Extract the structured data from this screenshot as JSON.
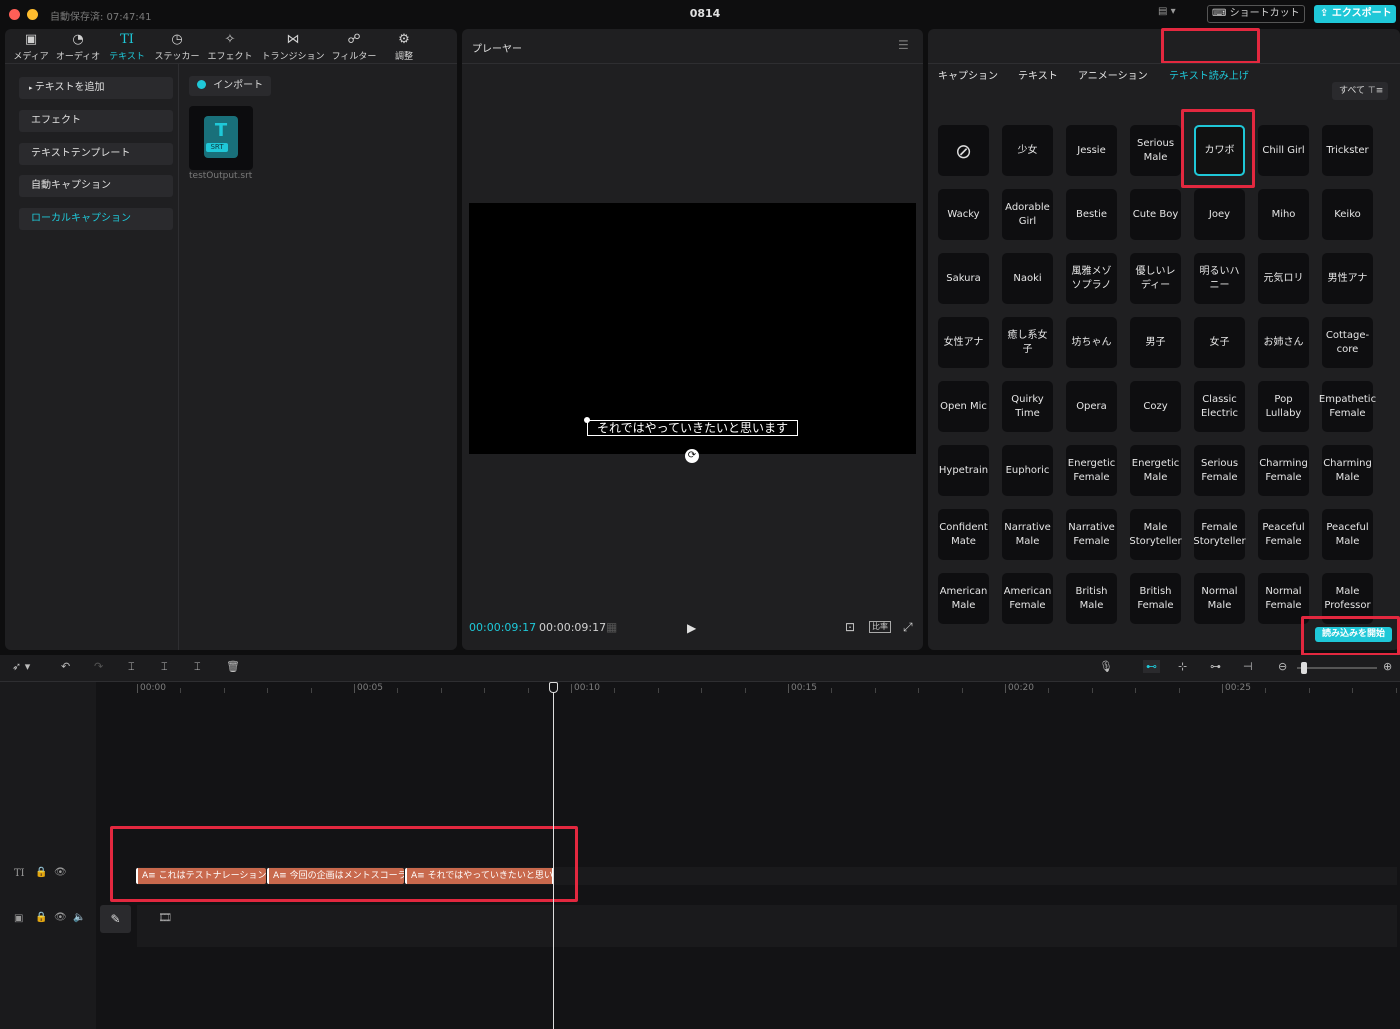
{
  "window": {
    "autosave": "自動保存済: 07:47:41",
    "title": "0814",
    "shortcut_label": "ショートカット",
    "export_label": "エクスポート"
  },
  "toolbar": {
    "tools": [
      {
        "label": "メディア",
        "icon": "media-icon"
      },
      {
        "label": "オーディオ",
        "icon": "audio-icon"
      },
      {
        "label": "テキスト",
        "icon": "text-icon"
      },
      {
        "label": "ステッカー",
        "icon": "sticker-icon"
      },
      {
        "label": "エフェクト",
        "icon": "effect-icon"
      },
      {
        "label": "トランジション",
        "icon": "transition-icon"
      },
      {
        "label": "フィルター",
        "icon": "filter-icon"
      },
      {
        "label": "調整",
        "icon": "adjust-icon"
      }
    ]
  },
  "sidebar": {
    "items": [
      "テキストを追加",
      "エフェクト",
      "テキストテンプレート",
      "自動キャプション",
      "ローカルキャプション"
    ]
  },
  "media": {
    "import_label": "インポート",
    "file_badge": "SRT",
    "file_name": "testOutput.srt"
  },
  "player": {
    "title": "プレーヤー",
    "subtitle": "それではやっていきたいと思います",
    "time_current": "00:00:09:17",
    "time_total": "00:00:09:17",
    "ratio_label": "比率"
  },
  "right_panel": {
    "tabs": [
      "キャプション",
      "テキスト",
      "アニメーション",
      "テキスト読み上げ"
    ],
    "filter_label": "すべて",
    "voices": [
      "",
      "少女",
      "Jessie",
      "Serious Male",
      "カワボ",
      "Chill Girl",
      "Trickster",
      "Wacky",
      "Adorable Girl",
      "Bestie",
      "Cute Boy",
      "Joey",
      "Miho",
      "Keiko",
      "Sakura",
      "Naoki",
      "風雅メゾソプラノ",
      "優しいレディー",
      "明るいハニー",
      "元気ロリ",
      "男性アナ",
      "女性アナ",
      "癒し系女子",
      "坊ちゃん",
      "男子",
      "女子",
      "お姉さん",
      "Cottage-core",
      "Open Mic",
      "Quirky Time",
      "Opera",
      "Cozy",
      "Classic Electric",
      "Pop Lullaby",
      "Empathetic Female",
      "Hypetrain",
      "Euphoric",
      "Energetic Female",
      "Energetic Male",
      "Serious Female",
      "Charming Female",
      "Charming Male",
      "Confident Mate",
      "Narrative Male",
      "Narrative Female",
      "Male Storyteller",
      "Female Storyteller",
      "Peaceful Female",
      "Peaceful Male",
      "American Male",
      "American Female",
      "British Male",
      "British Female",
      "Normal Male",
      "Normal Female",
      "Male Professor"
    ],
    "start_button": "読み込みを開始"
  },
  "timeline": {
    "ticks": [
      "00:00",
      "00:05",
      "00:10",
      "00:15",
      "00:20",
      "00:25"
    ],
    "clips": [
      "これはテストナレーション",
      "今回の企画はメントスコーラ",
      "それではやっていきたいと思います"
    ],
    "clip_prefix": "A≡"
  },
  "colors": {
    "accent": "#1fc8d8",
    "highlight": "#e3283f",
    "clip": "#c8694d"
  }
}
